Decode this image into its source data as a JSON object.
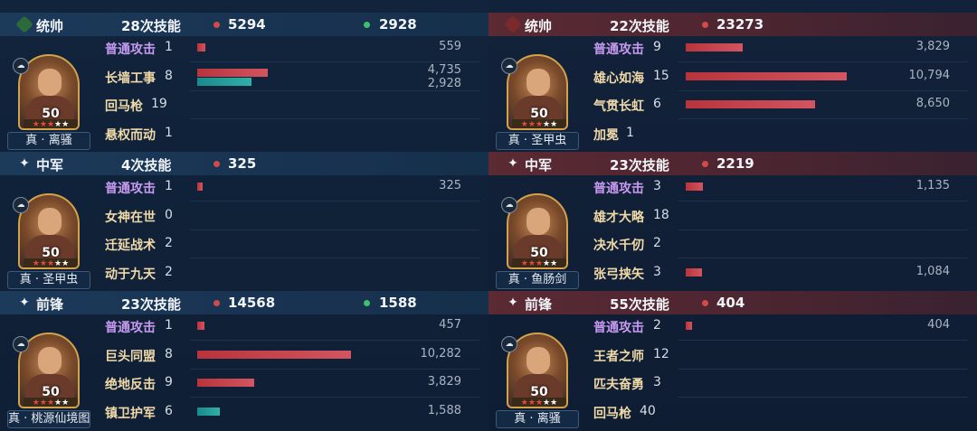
{
  "colors": {
    "damage_bar": "#d35560",
    "heal_bar": "#2fb0a8",
    "damage_dot": "#d24a4a",
    "heal_dot": "#3fbf6f",
    "basic_attack_text": "#c79af0",
    "skill_text": "#f0d9a8",
    "left_header": "#1c3a5a",
    "right_header": "#5b2a33"
  },
  "max_value": 10794,
  "left": {
    "sections": [
      {
        "role": "统帅",
        "role_icon": "commander-gem-icon",
        "casts": "28次技能",
        "damage": "5294",
        "heal": "2928",
        "hero": {
          "level": "50",
          "stars_red": 3,
          "stars_total": 5,
          "name": "真 · 离骚"
        },
        "skills": [
          {
            "name": "普通攻击",
            "count": "1",
            "basic": true,
            "damage": 559,
            "damage_label": "559"
          },
          {
            "name": "长墙工事",
            "count": "8",
            "damage": 4735,
            "damage_label": "4,735",
            "heal": 2928,
            "heal_label": "2,928"
          },
          {
            "name": "回马枪",
            "count": "19"
          },
          {
            "name": "悬权而动",
            "count": "1"
          }
        ]
      },
      {
        "role": "中军",
        "role_icon": "sparkle-icon",
        "casts": "4次技能",
        "damage": "325",
        "heal": "",
        "hero": {
          "level": "50",
          "stars_red": 3,
          "stars_total": 5,
          "name": "真 · 圣甲虫"
        },
        "skills": [
          {
            "name": "普通攻击",
            "count": "1",
            "basic": true,
            "damage": 325,
            "damage_label": "325"
          },
          {
            "name": "女神在世",
            "count": "0"
          },
          {
            "name": "迁延战术",
            "count": "2"
          },
          {
            "name": "动于九天",
            "count": "2"
          }
        ]
      },
      {
        "role": "前锋",
        "role_icon": "sparkle-icon",
        "casts": "23次技能",
        "damage": "14568",
        "heal": "1588",
        "hero": {
          "level": "50",
          "stars_red": 3,
          "stars_total": 5,
          "name": "真 · 桃源仙境图"
        },
        "skills": [
          {
            "name": "普通攻击",
            "count": "1",
            "basic": true,
            "damage": 457,
            "damage_label": "457"
          },
          {
            "name": "巨头同盟",
            "count": "8",
            "damage": 10282,
            "damage_label": "10,282"
          },
          {
            "name": "绝地反击",
            "count": "9",
            "damage": 3829,
            "damage_label": "3,829"
          },
          {
            "name": "镇卫护军",
            "count": "6",
            "heal": 1588,
            "heal_label": "1,588"
          }
        ]
      }
    ]
  },
  "right": {
    "sections": [
      {
        "role": "统帅",
        "role_icon": "commander-gem-icon",
        "casts": "22次技能",
        "damage": "23273",
        "heal": "",
        "hero": {
          "level": "50",
          "stars_red": 3,
          "stars_total": 5,
          "name": "真 · 圣甲虫"
        },
        "skills": [
          {
            "name": "普通攻击",
            "count": "9",
            "basic": true,
            "damage": 3829,
            "damage_label": "3,829"
          },
          {
            "name": "雄心如海",
            "count": "15",
            "damage": 10794,
            "damage_label": "10,794"
          },
          {
            "name": "气贯长虹",
            "count": "6",
            "damage": 8650,
            "damage_label": "8,650"
          },
          {
            "name": "加冕",
            "count": "1"
          }
        ]
      },
      {
        "role": "中军",
        "role_icon": "sparkle-icon",
        "casts": "23次技能",
        "damage": "2219",
        "heal": "",
        "hero": {
          "level": "50",
          "stars_red": 3,
          "stars_total": 5,
          "name": "真 · 鱼肠剑"
        },
        "skills": [
          {
            "name": "普通攻击",
            "count": "3",
            "basic": true,
            "damage": 1135,
            "damage_label": "1,135"
          },
          {
            "name": "雄才大略",
            "count": "18"
          },
          {
            "name": "决水千仞",
            "count": "2"
          },
          {
            "name": "张弓挟矢",
            "count": "3",
            "damage": 1084,
            "damage_label": "1,084"
          }
        ]
      },
      {
        "role": "前锋",
        "role_icon": "sparkle-icon",
        "casts": "55次技能",
        "damage": "404",
        "heal": "",
        "hero": {
          "level": "50",
          "stars_red": 3,
          "stars_total": 5,
          "name": "真 · 离骚"
        },
        "skills": [
          {
            "name": "普通攻击",
            "count": "2",
            "basic": true,
            "damage": 404,
            "damage_label": "404"
          },
          {
            "name": "王者之师",
            "count": "12"
          },
          {
            "name": "匹夫奋勇",
            "count": "3"
          },
          {
            "name": "回马枪",
            "count": "40"
          }
        ]
      }
    ]
  }
}
